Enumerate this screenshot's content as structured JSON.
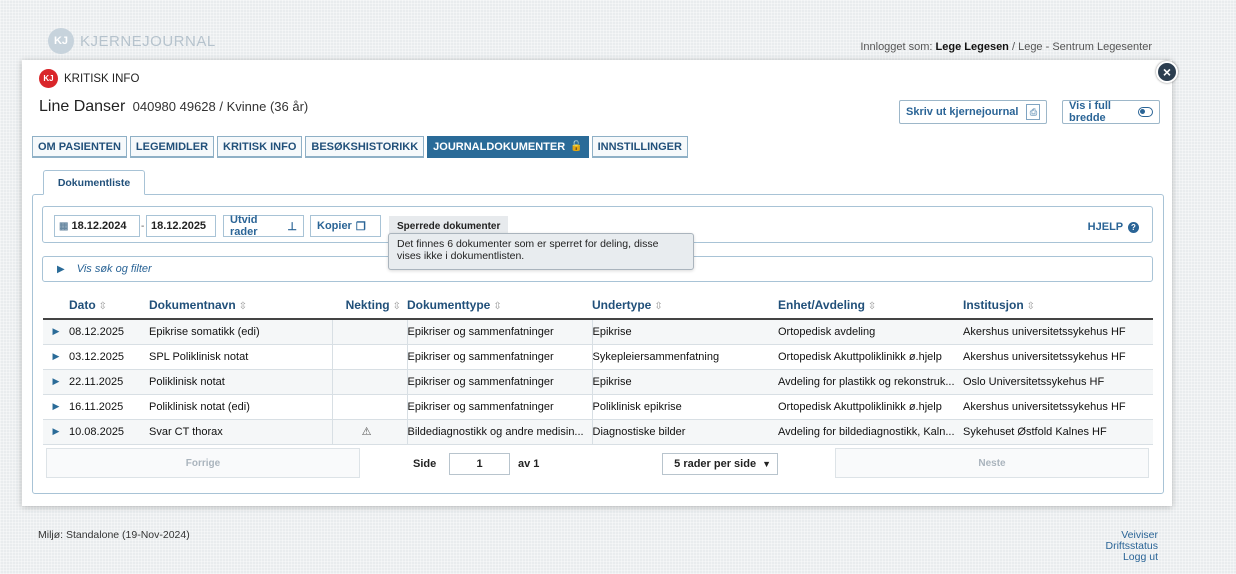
{
  "header": {
    "logo_mark": "KJ",
    "logo_text": "KJERNEJOURNAL",
    "login_prefix": "Innlogget som:",
    "login_user": "Lege Legesen",
    "login_role": "/ Lege - Sentrum Legesenter"
  },
  "critical": {
    "icon": "KJ",
    "label": "KRITISK INFO"
  },
  "patient": {
    "name": "Line Danser",
    "details": "040980 49628 / Kvinne (36 år)"
  },
  "actions": {
    "print_label": "Skriv ut kjernejournal",
    "fullwidth_label": "Vis i full bredde"
  },
  "tabs": [
    {
      "label": "OM PASIENTEN"
    },
    {
      "label": "LEGEMIDLER"
    },
    {
      "label": "KRITISK INFO"
    },
    {
      "label": "BESØKSHISTORIKK"
    },
    {
      "label": "JOURNALDOKUMENTER"
    },
    {
      "label": "INNSTILLINGER"
    }
  ],
  "subtab": "Dokumentliste",
  "toolbar": {
    "date_from": "18.12.2024",
    "date_to": "18.12.2025",
    "date_sep": "-",
    "expand_label": "Utvid rader",
    "copy_label": "Kopier",
    "blocked_title": "Sperrede dokumenter",
    "tooltip": "Det finnes 6 dokumenter som er sperret for deling, disse vises ikke i dokumentlisten.",
    "help_label": "HJELP"
  },
  "filter_label": "Vis søk og filter",
  "table": {
    "headers": [
      "Dato",
      "Dokumentnavn",
      "Nekting",
      "Dokumenttype",
      "Undertype",
      "Enhet/Avdeling",
      "Institusjon"
    ],
    "rows": [
      [
        "08.12.2025",
        "Epikrise somatikk (edi)",
        "",
        "Epikriser og sammenfatninger",
        "Epikrise",
        "Ortopedisk avdeling",
        "Akershus universitetssykehus HF"
      ],
      [
        "03.12.2025",
        "SPL Poliklinisk notat",
        "",
        "Epikriser og sammenfatninger",
        "Sykepleiersammenfatning",
        "Ortopedisk Akuttpoliklinikk ø.hjelp",
        "Akershus universitetssykehus HF"
      ],
      [
        "22.11.2025",
        "Poliklinisk notat",
        "",
        "Epikriser og sammenfatninger",
        "Epikrise",
        "Avdeling for plastikk og rekonstruk...",
        "Oslo Universitetssykehus HF"
      ],
      [
        "16.11.2025",
        "Poliklinisk notat (edi)",
        "",
        "Epikriser og sammenfatninger",
        "Poliklinisk epikrise",
        "Ortopedisk Akuttpoliklinikk ø.hjelp",
        "Akershus universitetssykehus HF"
      ],
      [
        "10.08.2025",
        "Svar CT thorax",
        "⚠",
        "Bildediagnostikk og andre medisin...",
        "Diagnostiske bilder",
        "Avdeling for bildediagnostikk, Kaln...",
        "Sykehuset Østfold Kalnes HF"
      ]
    ]
  },
  "pager": {
    "prev": "Forrige",
    "next": "Neste",
    "side_label": "Side",
    "page": "1",
    "of_label": "av 1",
    "rows_per_page": "5 rader per side"
  },
  "footer": {
    "env": "Miljø: Standalone (19-Nov-2024)",
    "links": [
      "Veiviser",
      "Driftsstatus",
      "Logg ut"
    ]
  },
  "colors": {
    "accent": "#2a6b98",
    "critical": "#d9262a",
    "link": "#2a6496"
  }
}
